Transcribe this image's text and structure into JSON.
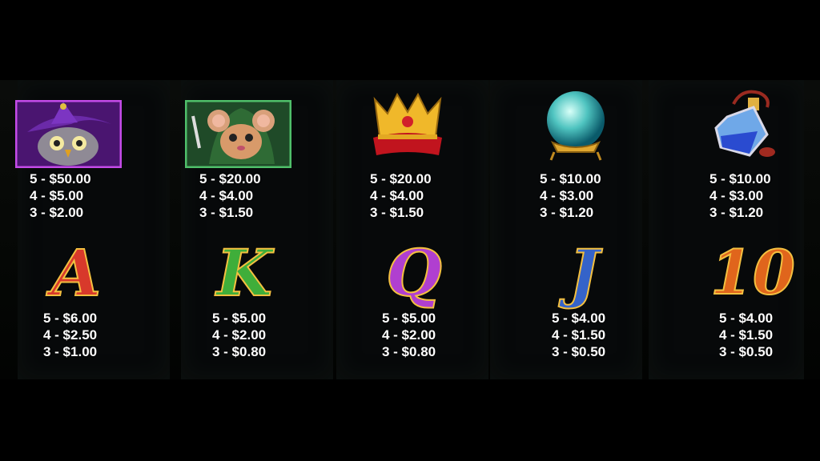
{
  "paytable": {
    "top_row": [
      {
        "icon": "wizard-owl-icon",
        "pays": [
          "5 - $50.00",
          "4 - $5.00",
          "3 - $2.00"
        ]
      },
      {
        "icon": "hooded-mouse-icon",
        "pays": [
          "5 - $20.00",
          "4 - $4.00",
          "3 - $1.50"
        ]
      },
      {
        "icon": "crown-icon",
        "pays": [
          "5 - $20.00",
          "4 - $4.00",
          "3 - $1.50"
        ]
      },
      {
        "icon": "crystal-ball-icon",
        "pays": [
          "5 - $10.00",
          "4 - $3.00",
          "3 - $1.20"
        ]
      },
      {
        "icon": "potion-bottle-icon",
        "pays": [
          "5 - $10.00",
          "4 - $3.00",
          "3 - $1.20"
        ]
      }
    ],
    "bottom_row": [
      {
        "letter": "A",
        "color": "#d8392b",
        "pays": [
          "5 - $6.00",
          "4 - $2.50",
          "3 - $1.00"
        ]
      },
      {
        "letter": "K",
        "color": "#3fae3a",
        "pays": [
          "5 - $5.00",
          "4 - $2.00",
          "3 - $0.80"
        ]
      },
      {
        "letter": "Q",
        "color": "#b03fd0",
        "pays": [
          "5 - $5.00",
          "4 - $2.00",
          "3 - $0.80"
        ]
      },
      {
        "letter": "J",
        "color": "#3563c9",
        "pays": [
          "5 - $4.00",
          "4 - $1.50",
          "3 - $0.50"
        ]
      },
      {
        "letter": "10",
        "color": "#e0651c",
        "pays": [
          "5 - $4.00",
          "4 - $1.50",
          "3 - $0.50"
        ]
      }
    ]
  }
}
